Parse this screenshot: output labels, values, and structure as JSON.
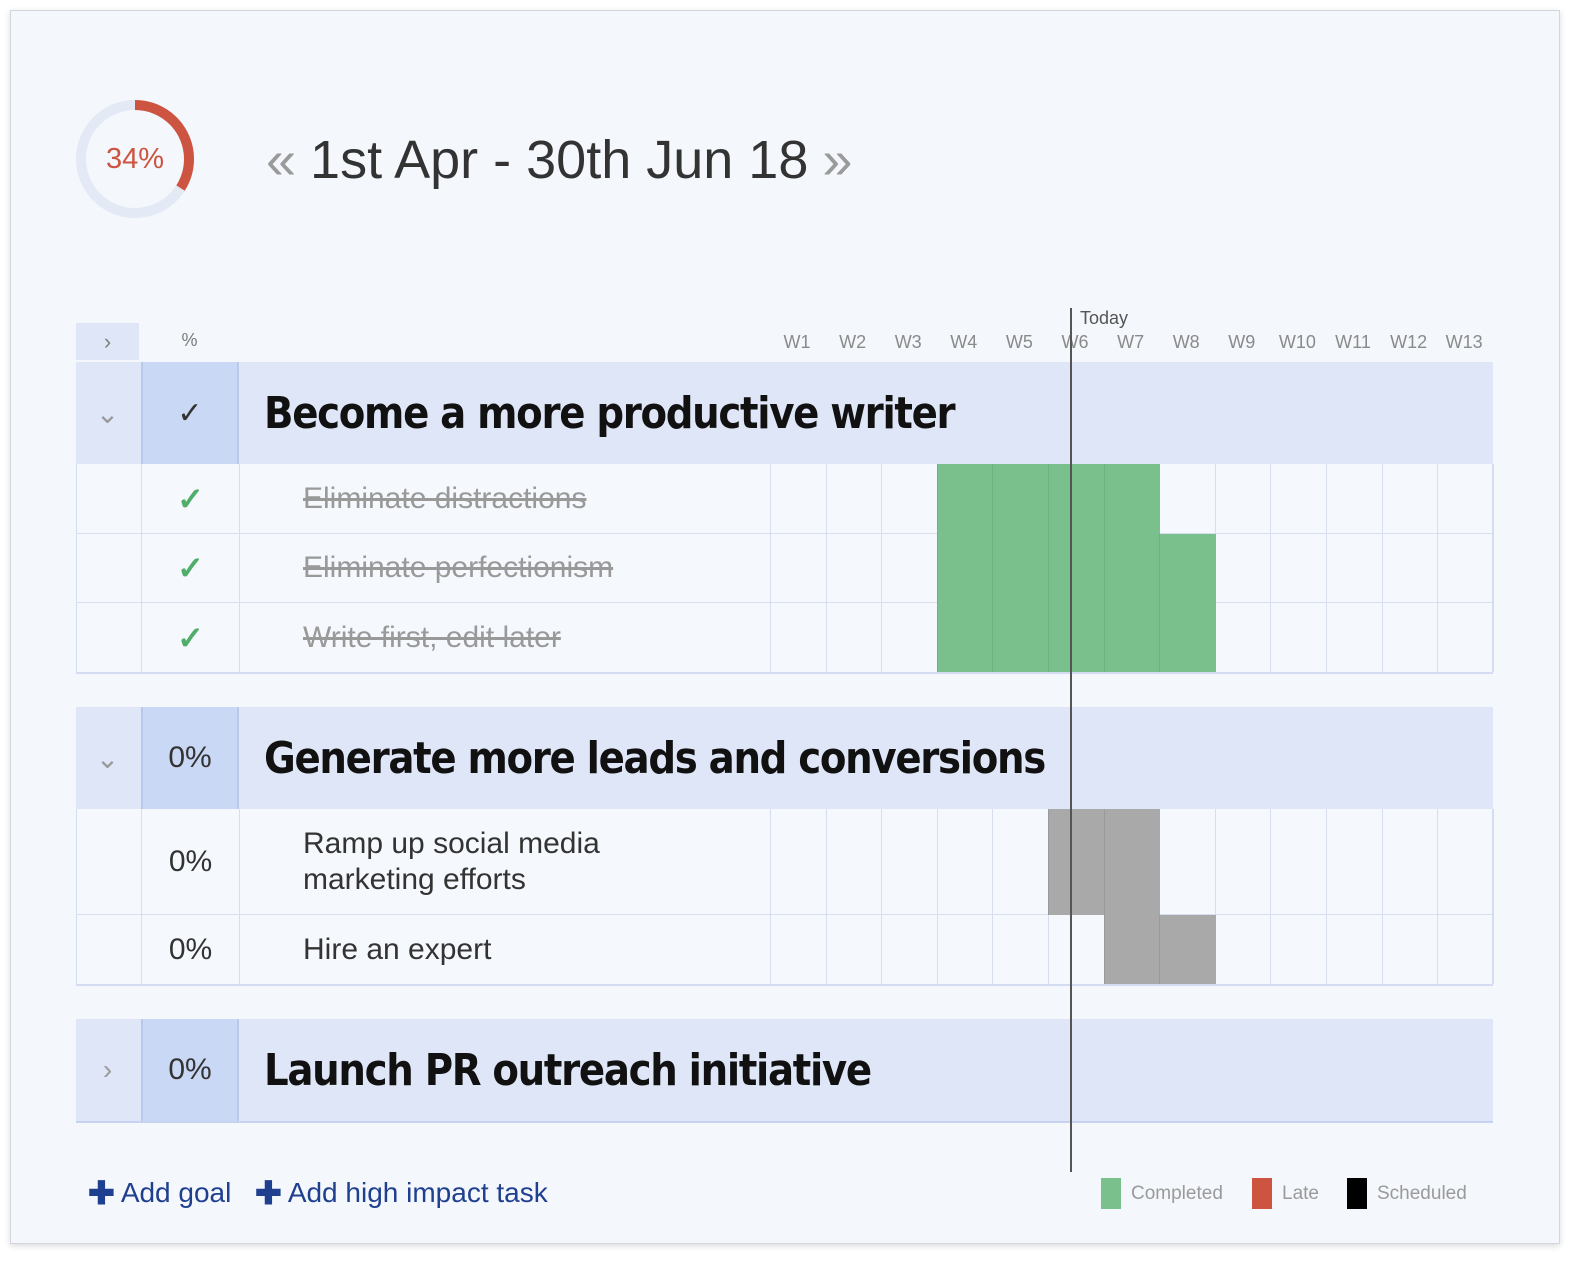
{
  "progress": {
    "value": 0.34,
    "label": "34%",
    "color": "#cd5440"
  },
  "header": {
    "prev_icon": "«",
    "title": "1st Apr - 30th Jun 18",
    "next_icon": "»"
  },
  "columns": {
    "toggle_icon": "›",
    "pct_label": "%",
    "today_label": "Today",
    "weeks": [
      "W1",
      "W2",
      "W3",
      "W4",
      "W5",
      "W6",
      "W7",
      "W8",
      "W9",
      "W10",
      "W11",
      "W12",
      "W13"
    ]
  },
  "goals": [
    {
      "toggle_icon": "⌄",
      "pct": "✓",
      "title": "Become a more productive writer",
      "tasks": [
        {
          "pct": "✓",
          "name": "Eliminate distractions",
          "done": true,
          "status": "completed",
          "weeks": [
            4,
            5,
            6,
            7
          ]
        },
        {
          "pct": "✓",
          "name": "Eliminate perfectionism",
          "done": true,
          "status": "completed",
          "weeks": [
            4,
            5,
            6,
            7,
            8
          ]
        },
        {
          "pct": "✓",
          "name": "Write first, edit later",
          "done": true,
          "status": "completed",
          "weeks": [
            4,
            5,
            6,
            7,
            8
          ]
        }
      ]
    },
    {
      "toggle_icon": "⌄",
      "pct": "0%",
      "title": "Generate more leads and conversions",
      "tasks": [
        {
          "pct": "0%",
          "name": "Ramp up social media marketing efforts",
          "done": false,
          "status": "scheduled",
          "weeks": [
            6,
            7
          ]
        },
        {
          "pct": "0%",
          "name": "Hire an expert",
          "done": false,
          "status": "scheduled",
          "weeks": [
            7,
            8
          ]
        }
      ]
    },
    {
      "toggle_icon": "›",
      "pct": "0%",
      "title": "Launch PR outreach initiative",
      "tasks": []
    }
  ],
  "footer": {
    "add_goal": "Add goal",
    "add_task": "Add high impact task",
    "plus_icon": "✚"
  },
  "legend": [
    {
      "label": "Completed",
      "color": "#7ac08d"
    },
    {
      "label": "Late",
      "color": "#cd5440"
    },
    {
      "label": "Scheduled",
      "color": "#000000"
    }
  ],
  "colors": {
    "completed": "#7ac08d",
    "scheduled": "#a9a9a9",
    "goal_bg": "#dfe6f7",
    "link": "#1f3f8f"
  }
}
